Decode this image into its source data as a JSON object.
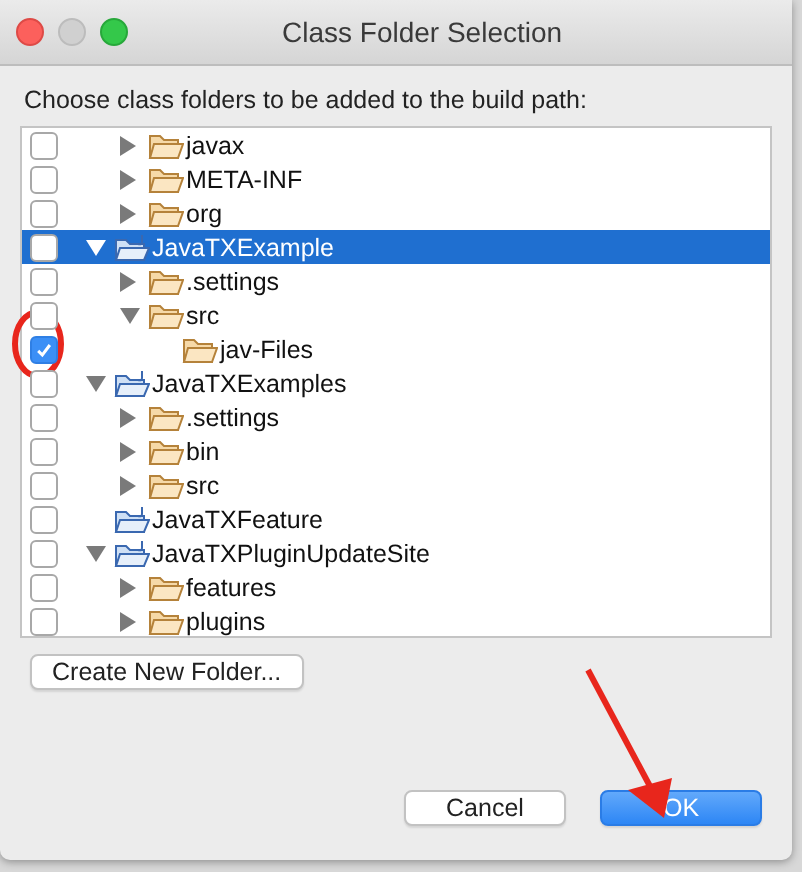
{
  "window": {
    "title": "Class Folder Selection"
  },
  "prompt": "Choose class folders to be added to the build path:",
  "tree": {
    "continued_children": [
      {
        "label": "javax",
        "kind": "folder",
        "expandable": true,
        "expanded": false,
        "checked": false,
        "selected": false
      },
      {
        "label": "META-INF",
        "kind": "folder",
        "expandable": true,
        "expanded": false,
        "checked": false,
        "selected": false
      },
      {
        "label": "org",
        "kind": "folder",
        "expandable": true,
        "expanded": false,
        "checked": false,
        "selected": false
      }
    ],
    "items": [
      {
        "label": "JavaTXExample",
        "kind": "project",
        "expandable": true,
        "expanded": true,
        "checked": false,
        "selected": true,
        "children": [
          {
            "label": ".settings",
            "kind": "folder",
            "expandable": true,
            "expanded": false,
            "checked": false,
            "selected": false
          },
          {
            "label": "src",
            "kind": "folder",
            "expandable": true,
            "expanded": true,
            "checked": false,
            "selected": false,
            "children": [
              {
                "label": "jav-Files",
                "kind": "folder",
                "expandable": false,
                "checked": true,
                "selected": false
              }
            ]
          }
        ]
      },
      {
        "label": "JavaTXExamples",
        "kind": "project",
        "expandable": true,
        "expanded": true,
        "checked": false,
        "selected": false,
        "children": [
          {
            "label": ".settings",
            "kind": "folder",
            "expandable": true,
            "expanded": false,
            "checked": false,
            "selected": false
          },
          {
            "label": "bin",
            "kind": "folder",
            "expandable": true,
            "expanded": false,
            "checked": false,
            "selected": false
          },
          {
            "label": "src",
            "kind": "folder",
            "expandable": true,
            "expanded": false,
            "checked": false,
            "selected": false
          }
        ]
      },
      {
        "label": "JavaTXFeature",
        "kind": "project",
        "expandable": false,
        "checked": false,
        "selected": false
      },
      {
        "label": "JavaTXPluginUpdateSite",
        "kind": "project",
        "expandable": true,
        "expanded": true,
        "checked": false,
        "selected": false,
        "children": [
          {
            "label": "features",
            "kind": "folder",
            "expandable": true,
            "expanded": false,
            "checked": false,
            "selected": false
          },
          {
            "label": "plugins",
            "kind": "folder",
            "expandable": true,
            "expanded": false,
            "checked": false,
            "selected": false
          }
        ]
      }
    ]
  },
  "create_button": "Create New Folder...",
  "buttons": [
    {
      "label": "Cancel",
      "kind": "normal"
    },
    {
      "label": "OK",
      "kind": "default"
    }
  ]
}
